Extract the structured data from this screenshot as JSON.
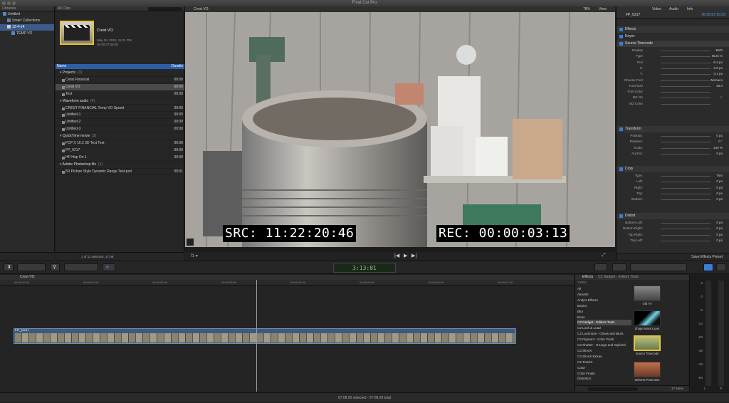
{
  "window": {
    "title": "Final Cut Pro"
  },
  "libraries": {
    "header": "Libraries",
    "items": [
      "Untitled",
      "Smart Collections",
      "12-4-14",
      "TEMP VO"
    ]
  },
  "browser": {
    "filter": "All Clips",
    "clip_name": "Crest VO",
    "clip_date": "May 26, 2013, 11:01 PM",
    "clip_duration": "00:00:07;08;00",
    "col_name": "Name",
    "col_duration": "Duratio",
    "groups": [
      {
        "name": "Projects",
        "count": "(3)",
        "items": [
          {
            "name": "Crest Financial",
            "dur": "00:00"
          },
          {
            "name": "Crest VO",
            "dur": "00:00",
            "selected": true
          },
          {
            "name": "Text",
            "dur": "00:00"
          }
        ]
      },
      {
        "name": "Waveform audio",
        "count": "(4)",
        "items": [
          {
            "name": "CREST FINANCIAL Temp VO Speed",
            "dur": "00:00"
          },
          {
            "name": "Untitled-1",
            "dur": "00:00"
          },
          {
            "name": "Untitled-2",
            "dur": "00:00"
          },
          {
            "name": "Untitled-3",
            "dur": "00:00"
          }
        ]
      },
      {
        "name": "QuickTime movie",
        "count": "(3)",
        "items": [
          {
            "name": "FCP X 10.2 3D Text Test",
            "dur": "00:00"
          },
          {
            "name": "FP_0217",
            "dur": "00:00"
          },
          {
            "name": "HP Hop On 1",
            "dur": "00:00"
          }
        ]
      },
      {
        "name": "Adobe Photoshop file",
        "count": "(1)",
        "items": [
          {
            "name": "5D Picture Style Dynamic Range Test.psd",
            "dur": "00:01"
          }
        ]
      }
    ],
    "footer": "1 of 11 selected, 17:08"
  },
  "viewer": {
    "title": "Crest VO",
    "zoom": "78%",
    "view": "View",
    "src_tc": "SRC: 11:22:20:46",
    "rec_tc": "REC: 00:00:03:13"
  },
  "inspector": {
    "tabs": [
      "Video",
      "Audio",
      "Info"
    ],
    "clip": "FP_0217",
    "tc": "00:00:07:20:20",
    "sections": {
      "effects": "Effects",
      "keyer": "Keyer:",
      "source_tc": "Source Timecode",
      "transform": "Transform",
      "crop": "Crop",
      "distort": "Distort"
    },
    "src_rows": [
      {
        "label": "Display",
        "value": "Both"
      },
      {
        "label": "Type",
        "value": "Burn In"
      },
      {
        "label": "Pos",
        "value": "-0.4 px"
      },
      {
        "label": "X:",
        "value": "0.0 px"
      },
      {
        "label": "Y:",
        "value": "0.1 px"
      },
      {
        "label": "Choose Font",
        "value": "Monaco"
      },
      {
        "label": "Font Size",
        "value": "48.0"
      },
      {
        "label": "Font Color",
        "value": ""
      },
      {
        "label": "BG On",
        "value": "✓"
      },
      {
        "label": "BG Color",
        "value": ""
      }
    ],
    "transform_rows": [
      {
        "label": "Position:",
        "value": "0 px"
      },
      {
        "label": "Rotation:",
        "value": "0 °"
      },
      {
        "label": "Scale:",
        "value": "100 %"
      },
      {
        "label": "Anchor:",
        "value": "0 px"
      }
    ],
    "crop_rows": [
      {
        "label": "Type:",
        "value": "Trim"
      },
      {
        "label": "Left:",
        "value": "0 px"
      },
      {
        "label": "Right:",
        "value": "0 px"
      },
      {
        "label": "Top:",
        "value": "0 px"
      },
      {
        "label": "Bottom:",
        "value": "0 px"
      }
    ],
    "distort_rows": [
      {
        "label": "Bottom Left:",
        "value": "0 px"
      },
      {
        "label": "Bottom Right:",
        "value": "0 px"
      },
      {
        "label": "Top Right:",
        "value": "0 px"
      },
      {
        "label": "Top Left:",
        "value": "0 px"
      }
    ],
    "save_preset": "Save Effects Preset"
  },
  "toolbar": {
    "timecode": "3:13:01"
  },
  "timeline": {
    "project": "Crest VO",
    "ruler": [
      "00:00:00:00",
      "00:00:01:00",
      "00:00:02:00",
      "00:00:03:00",
      "00:00:04:00",
      "00:00:05:00",
      "00:00:06:00",
      "00:00:07:00"
    ],
    "clip_name": "FP_0217"
  },
  "effects": {
    "title": "Effects",
    "path": "C2 Gadget - Editors Tools",
    "cat_header": "VIDEO",
    "categories": [
      "All",
      "AlexHD",
      "Andy's Effects",
      "Basics",
      "Blur",
      "Bons",
      "C2 Gadget - Editors Tools",
      "C2 Lock & Load",
      "C2 Luminous - Glows and Blurs",
      "C2 Pigment - Color Tools",
      "C2 Shatter - Grunge and Stylized",
      "C2 SliceX",
      "C2 SliceX Extras",
      "C2 TrackX",
      "Color",
      "Color Finale",
      "Distortion"
    ],
    "selected_category": "C2 Gadget - Editors Tools",
    "thumbs": [
      "Old TV",
      "Shape Mask Layer",
      "Source Timecode",
      "Witness Protection"
    ],
    "count": "17 items"
  },
  "meters": {
    "labels": [
      "6",
      "0",
      "-6",
      "-12",
      "-20",
      "-30",
      "-40",
      "-50"
    ],
    "l": "L",
    "r": "R"
  },
  "status": {
    "text": "07:08.00 selected - 07:08.20 total"
  }
}
